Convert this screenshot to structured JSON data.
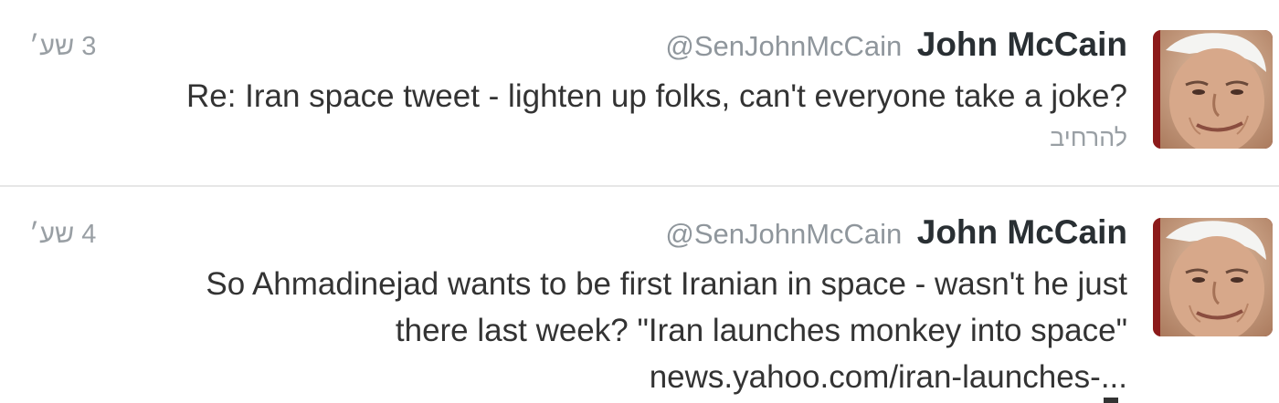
{
  "tweets": [
    {
      "name": "John McCain",
      "handle": "@SenJohnMcCain",
      "time": "3 שע׳",
      "text_lines": [
        "Re: Iran space tweet - lighten up folks, can't everyone take a joke?"
      ],
      "expand_label": "להרחיב"
    },
    {
      "name": "John McCain",
      "handle": "@SenJohnMcCain",
      "time": "4 שע׳",
      "text_lines": [
        "So Ahmadinejad wants to be first Iranian in space - wasn't he just",
        "there last week? \"Iran launches monkey into space\""
      ],
      "link_text": "news.yahoo.com/iran-launches-..."
    }
  ],
  "colors": {
    "name": "#292f33",
    "secondary": "#8f969c",
    "text": "#333333",
    "divider": "#e6e6e6"
  },
  "icons": {
    "avatar": "profile-photo"
  }
}
